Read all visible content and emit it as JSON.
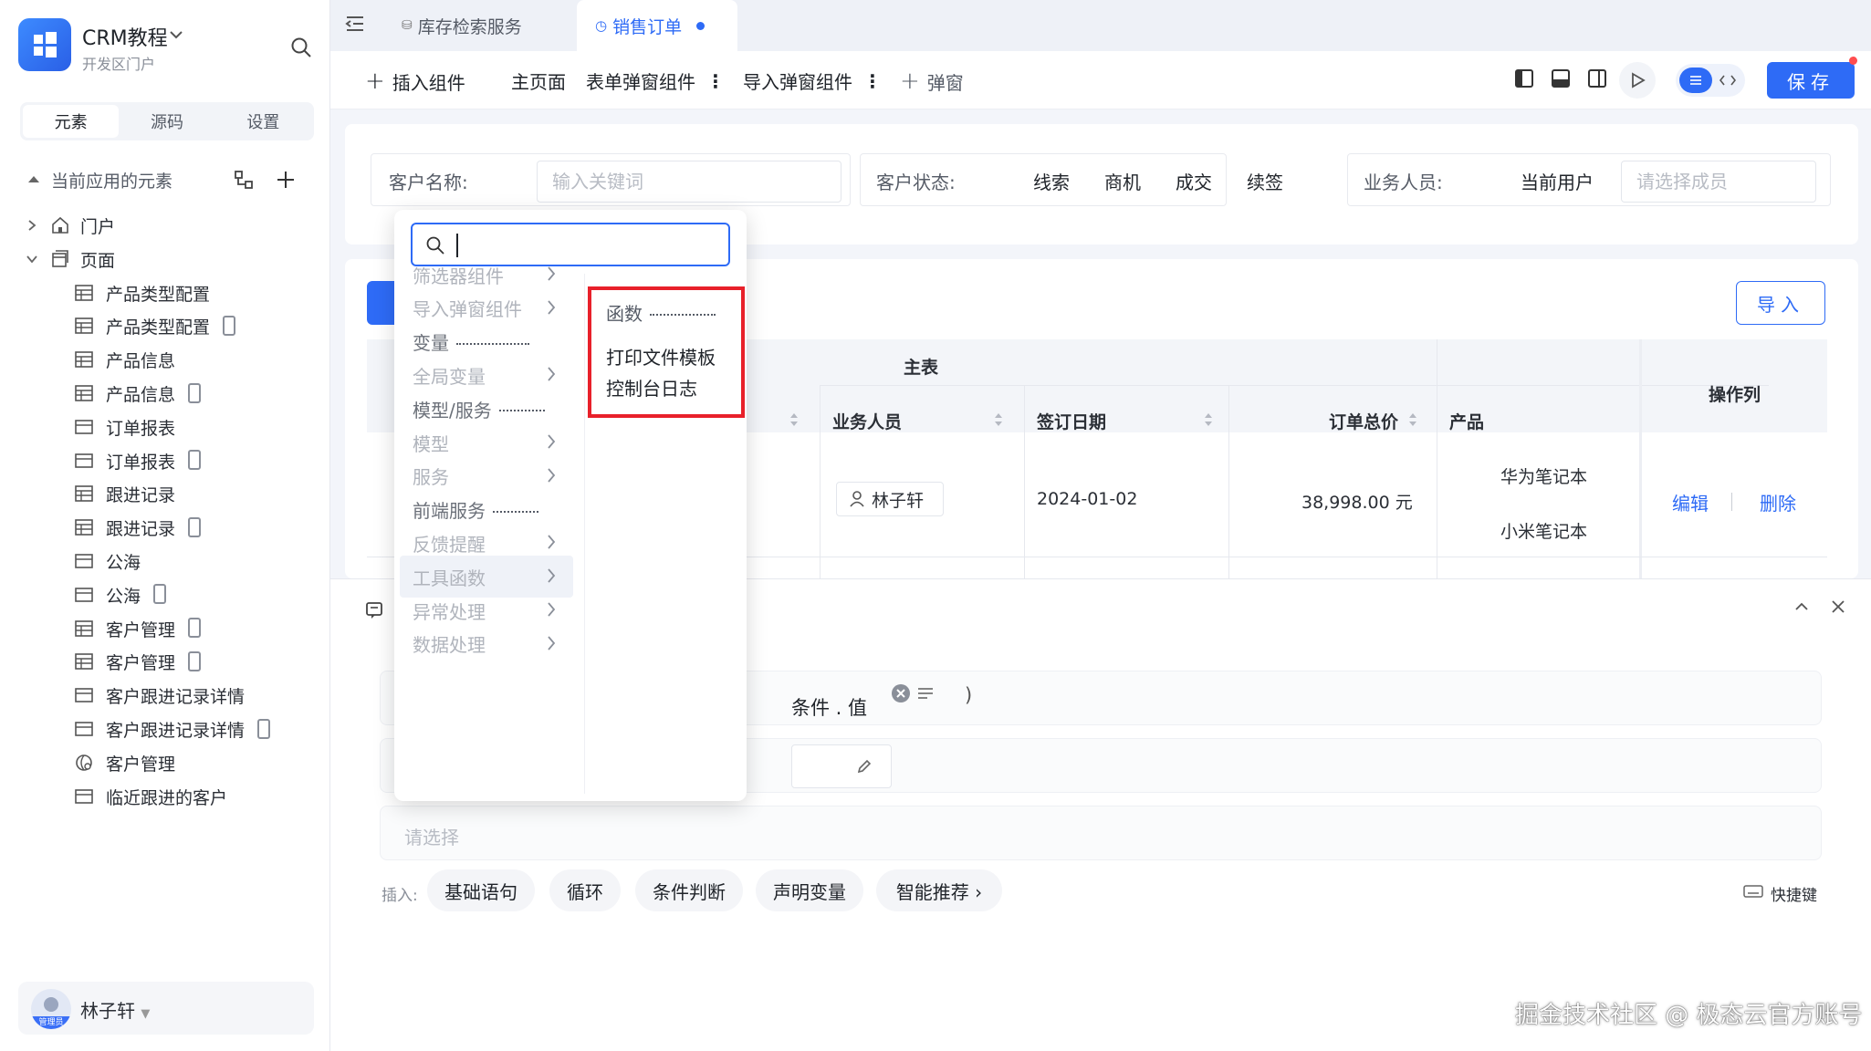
{
  "sidebar": {
    "app_title": "CRM教程",
    "app_subtitle": "开发区门户",
    "tabs": [
      "元素",
      "源码",
      "设置"
    ],
    "section_title": "当前应用的元素",
    "tree": [
      {
        "label": "门户",
        "icon": "home-icon",
        "mobile": false,
        "level": 0
      },
      {
        "label": "页面",
        "icon": "pages-icon",
        "mobile": false,
        "level": 0
      },
      {
        "label": "产品类型配置",
        "icon": "table-icon",
        "mobile": false,
        "level": 1
      },
      {
        "label": "产品类型配置",
        "icon": "table-icon",
        "mobile": true,
        "level": 1
      },
      {
        "label": "产品信息",
        "icon": "table-icon",
        "mobile": false,
        "level": 1
      },
      {
        "label": "产品信息",
        "icon": "table-icon",
        "mobile": true,
        "level": 1
      },
      {
        "label": "订单报表",
        "icon": "report-icon",
        "mobile": false,
        "level": 1
      },
      {
        "label": "订单报表",
        "icon": "report-icon",
        "mobile": true,
        "level": 1
      },
      {
        "label": "跟进记录",
        "icon": "table-icon",
        "mobile": false,
        "level": 1
      },
      {
        "label": "跟进记录",
        "icon": "table-icon",
        "mobile": true,
        "level": 1
      },
      {
        "label": "公海",
        "icon": "report-icon",
        "mobile": false,
        "level": 1
      },
      {
        "label": "公海",
        "icon": "report-icon",
        "mobile": true,
        "level": 1
      },
      {
        "label": "客户管理",
        "icon": "table-icon",
        "mobile": true,
        "level": 1
      },
      {
        "label": "客户管理",
        "icon": "table-icon",
        "mobile": true,
        "level": 1
      },
      {
        "label": "客户跟进记录详情",
        "icon": "report-icon",
        "mobile": false,
        "level": 1
      },
      {
        "label": "客户跟进记录详情",
        "icon": "report-icon",
        "mobile": true,
        "level": 1
      },
      {
        "label": "客户管理",
        "icon": "globe-icon",
        "mobile": false,
        "level": 1
      },
      {
        "label": "临近跟进的客户",
        "icon": "report-icon",
        "mobile": false,
        "level": 1
      }
    ],
    "user": {
      "name": "林子轩",
      "role_tag": "管理员"
    }
  },
  "page_tabs": [
    {
      "label": "库存检索服务",
      "active": false
    },
    {
      "label": "销售订单",
      "active": true
    }
  ],
  "toolbar": {
    "insert": "插入组件",
    "main_page": "主页面",
    "form_popup": "表单弹窗组件",
    "import_popup": "导入弹窗组件",
    "popup": "弹窗",
    "save": "保存"
  },
  "filter": {
    "customer_label": "客户名称:",
    "customer_placeholder": "输入关键词",
    "status_label": "客户状态:",
    "status_options": [
      "线索",
      "商机",
      "成交",
      "续签"
    ],
    "sales_label": "业务人员:",
    "sales_current": "当前用户",
    "sales_placeholder": "请选择成员"
  },
  "table": {
    "import_button": "导入",
    "group_header": "主表",
    "columns": [
      "业务人员",
      "签订日期",
      "订单总价",
      "产品",
      "操作列"
    ],
    "row": {
      "salesperson": "林子轩",
      "date": "2024-01-02",
      "total": "38,998.00 元",
      "products": [
        "华为笔记本",
        "小米笔记本"
      ],
      "edit": "编辑",
      "delete": "删除"
    }
  },
  "bottom_panel": {
    "condition_text": "条件 . 值",
    "condition_suffix": ")",
    "select_placeholder": "请选择",
    "insert_label": "插入:",
    "chips": [
      "基础语句",
      "循环",
      "条件判断",
      "声明变量",
      "智能推荐 ›"
    ],
    "shortcut_label": "快捷键"
  },
  "popup": {
    "search_value": "",
    "menu": [
      {
        "label": "筛选器组件",
        "has_sub": true,
        "style": "light"
      },
      {
        "label": "导入弹窗组件",
        "has_sub": true,
        "style": "light"
      },
      {
        "label": "变量",
        "has_sub": false,
        "style": "dark"
      },
      {
        "label": "全局变量",
        "has_sub": true,
        "style": "light"
      },
      {
        "label": "模型/服务",
        "has_sub": false,
        "style": "dark"
      },
      {
        "label": "模型",
        "has_sub": true,
        "style": "light"
      },
      {
        "label": "服务",
        "has_sub": true,
        "style": "light"
      },
      {
        "label": "前端服务",
        "has_sub": false,
        "style": "dark"
      },
      {
        "label": "反馈提醒",
        "has_sub": true,
        "style": "light"
      },
      {
        "label": "工具函数",
        "has_sub": true,
        "style": "highlight"
      },
      {
        "label": "异常处理",
        "has_sub": true,
        "style": "light"
      },
      {
        "label": "数据处理",
        "has_sub": true,
        "style": "light"
      }
    ],
    "submenu": [
      "函数",
      "打印文件模板",
      "控制台日志"
    ]
  },
  "watermark": "掘金技术社区 @ 极态云官方账号",
  "colors": {
    "primary": "#2e6bf6",
    "highlight_border": "#e8202a"
  }
}
